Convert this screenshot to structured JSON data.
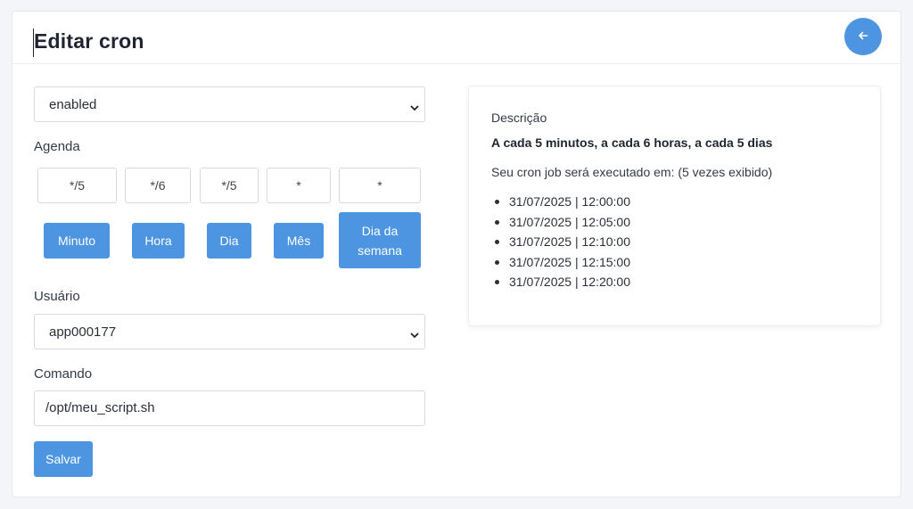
{
  "header": {
    "title": "Editar cron"
  },
  "status_select": {
    "value": "enabled"
  },
  "schedule": {
    "label": "Agenda",
    "fields": [
      {
        "value": "*/5",
        "button": "Minuto"
      },
      {
        "value": "*/6",
        "button": "Hora"
      },
      {
        "value": "*/5",
        "button": "Dia"
      },
      {
        "value": "*",
        "button": "Mês"
      },
      {
        "value": "*",
        "button": "Dia da semana"
      }
    ]
  },
  "user": {
    "label": "Usuário",
    "value": "app000177"
  },
  "command": {
    "label": "Comando",
    "value": "/opt/meu_script.sh"
  },
  "save_label": "Salvar",
  "description": {
    "title": "Descrição",
    "summary": "A cada 5 minutos, a cada 6 horas, a cada 5 dias",
    "execution_text": "Seu cron job será executado em: (5 vezes exibido)",
    "runs": [
      "31/07/2025 | 12:00:00",
      "31/07/2025 | 12:05:00",
      "31/07/2025 | 12:10:00",
      "31/07/2025 | 12:15:00",
      "31/07/2025 | 12:20:00"
    ]
  },
  "colors": {
    "accent": "#4d95e0",
    "background": "#f4f5f8",
    "card": "#ffffff"
  },
  "icons": {
    "back": "arrow-left-icon",
    "select": "chevron-down-icon"
  }
}
